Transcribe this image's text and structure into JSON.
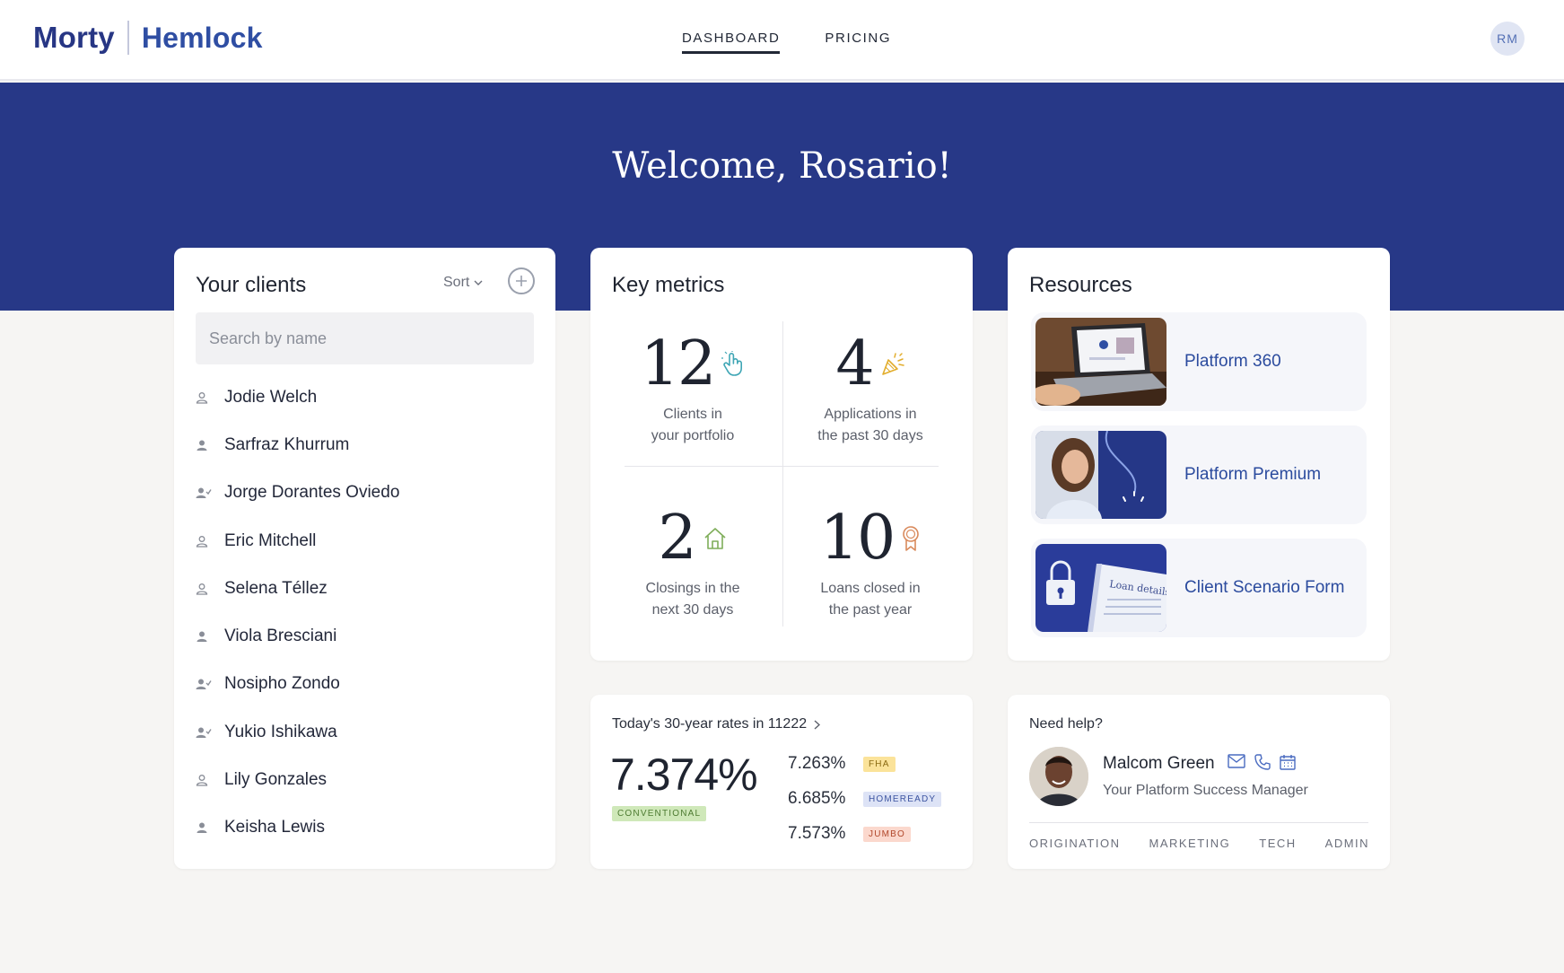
{
  "header": {
    "brand_primary": "Morty",
    "brand_secondary": "Hemlock",
    "nav": [
      {
        "label": "DASHBOARD",
        "active": true
      },
      {
        "label": "PRICING",
        "active": false
      }
    ],
    "avatar_initials": "RM"
  },
  "hero": {
    "welcome": "Welcome, Rosario!"
  },
  "clients": {
    "title": "Your clients",
    "sort_label": "Sort",
    "search_placeholder": "Search by name",
    "items": [
      {
        "name": "Jodie Welch",
        "icon": "person-outline-icon"
      },
      {
        "name": "Sarfraz Khurrum",
        "icon": "person-filled-icon"
      },
      {
        "name": "Jorge Dorantes Oviedo",
        "icon": "person-check-icon"
      },
      {
        "name": "Eric Mitchell",
        "icon": "person-outline-icon"
      },
      {
        "name": "Selena Téllez",
        "icon": "person-outline-icon"
      },
      {
        "name": "Viola Bresciani",
        "icon": "person-filled-icon"
      },
      {
        "name": "Nosipho Zondo",
        "icon": "person-check-icon"
      },
      {
        "name": "Yukio Ishikawa",
        "icon": "person-check-icon"
      },
      {
        "name": "Lily Gonzales",
        "icon": "person-outline-icon"
      },
      {
        "name": "Keisha Lewis",
        "icon": "person-filled-icon"
      }
    ]
  },
  "metrics": {
    "title": "Key metrics",
    "items": [
      {
        "value": "12",
        "label_line1": "Clients in",
        "label_line2": "your portfolio",
        "icon": "hand-pointer-icon",
        "color": "#3fa6b5"
      },
      {
        "value": "4",
        "label_line1": "Applications in",
        "label_line2": "the past 30 days",
        "icon": "party-popper-icon",
        "color": "#e2ad2c"
      },
      {
        "value": "2",
        "label_line1": "Closings in the",
        "label_line2": "next 30 days",
        "icon": "house-icon",
        "color": "#7fae5a"
      },
      {
        "value": "10",
        "label_line1": "Loans closed in",
        "label_line2": "the past year",
        "icon": "award-ribbon-icon",
        "color": "#d98a5c"
      }
    ]
  },
  "resources": {
    "title": "Resources",
    "items": [
      {
        "label": "Platform 360"
      },
      {
        "label": "Platform Premium"
      },
      {
        "label": "Client Scenario Form",
        "thumb_text": "Loan details"
      }
    ]
  },
  "rates": {
    "heading": "Today's 30-year rates in 11222",
    "main_rate": "7.374%",
    "main_type": "CONVENTIONAL",
    "others": [
      {
        "rate": "7.263%",
        "type": "FHA"
      },
      {
        "rate": "6.685%",
        "type": "HOMEREADY"
      },
      {
        "rate": "7.573%",
        "type": "JUMBO"
      }
    ]
  },
  "help": {
    "heading": "Need help?",
    "manager_name": "Malcom Green",
    "manager_role": "Your Platform Success Manager",
    "links": [
      "ORIGINATION",
      "MARKETING",
      "TECH",
      "ADMIN"
    ]
  },
  "colors": {
    "brand_navy": "#273887",
    "link_blue": "#2b4b9e",
    "page_bg": "#f6f5f3"
  }
}
